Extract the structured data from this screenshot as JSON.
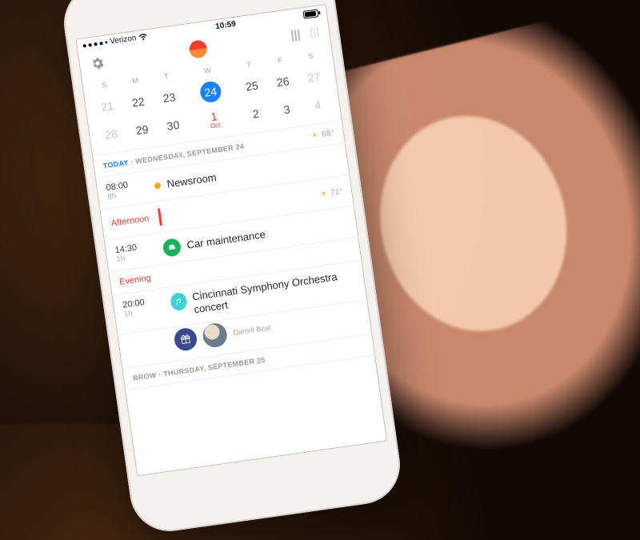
{
  "status": {
    "carrier": "Verizon",
    "time": "10:59"
  },
  "calendar": {
    "dow": [
      "S",
      "M",
      "T",
      "W",
      "T",
      "F",
      "S"
    ],
    "rows": [
      [
        "21",
        "22",
        "23",
        "24",
        "25",
        "26",
        "27"
      ],
      [
        "28",
        "29",
        "30",
        "1",
        "2",
        "3",
        "4"
      ]
    ],
    "selected": "24",
    "month_marker": {
      "day": "1",
      "label": "Oct"
    }
  },
  "agenda": {
    "today": {
      "headline_today": "TODAY",
      "headline_rest": " · WEDNESDAY, SEPTEMBER 24",
      "temp": "68°",
      "items": [
        {
          "kind": "event",
          "time": "08:00",
          "dur": "8h",
          "title": "Newsroom",
          "marker": "dot",
          "color": "#f5a623"
        },
        {
          "kind": "section",
          "label": "Afternoon",
          "temp": "71°"
        },
        {
          "kind": "event",
          "time": "14:30",
          "dur": "1h",
          "title": "Car maintenance",
          "marker": "icon",
          "icon": "car",
          "color": "#17b35a"
        },
        {
          "kind": "section",
          "label": "Evening"
        },
        {
          "kind": "event",
          "time": "20:00",
          "dur": "1h",
          "title": "Cincinnati Symphony Orchestra concert",
          "marker": "icon",
          "icon": "music",
          "color": "#3fd0d4",
          "people": [
            {
              "type": "gift"
            },
            {
              "type": "avatar",
              "name": "Darrell Beal"
            }
          ]
        }
      ]
    },
    "tomorrow": {
      "headline_prefix": "RROW",
      "headline_rest": " · THURSDAY, SEPTEMBER 25"
    }
  }
}
